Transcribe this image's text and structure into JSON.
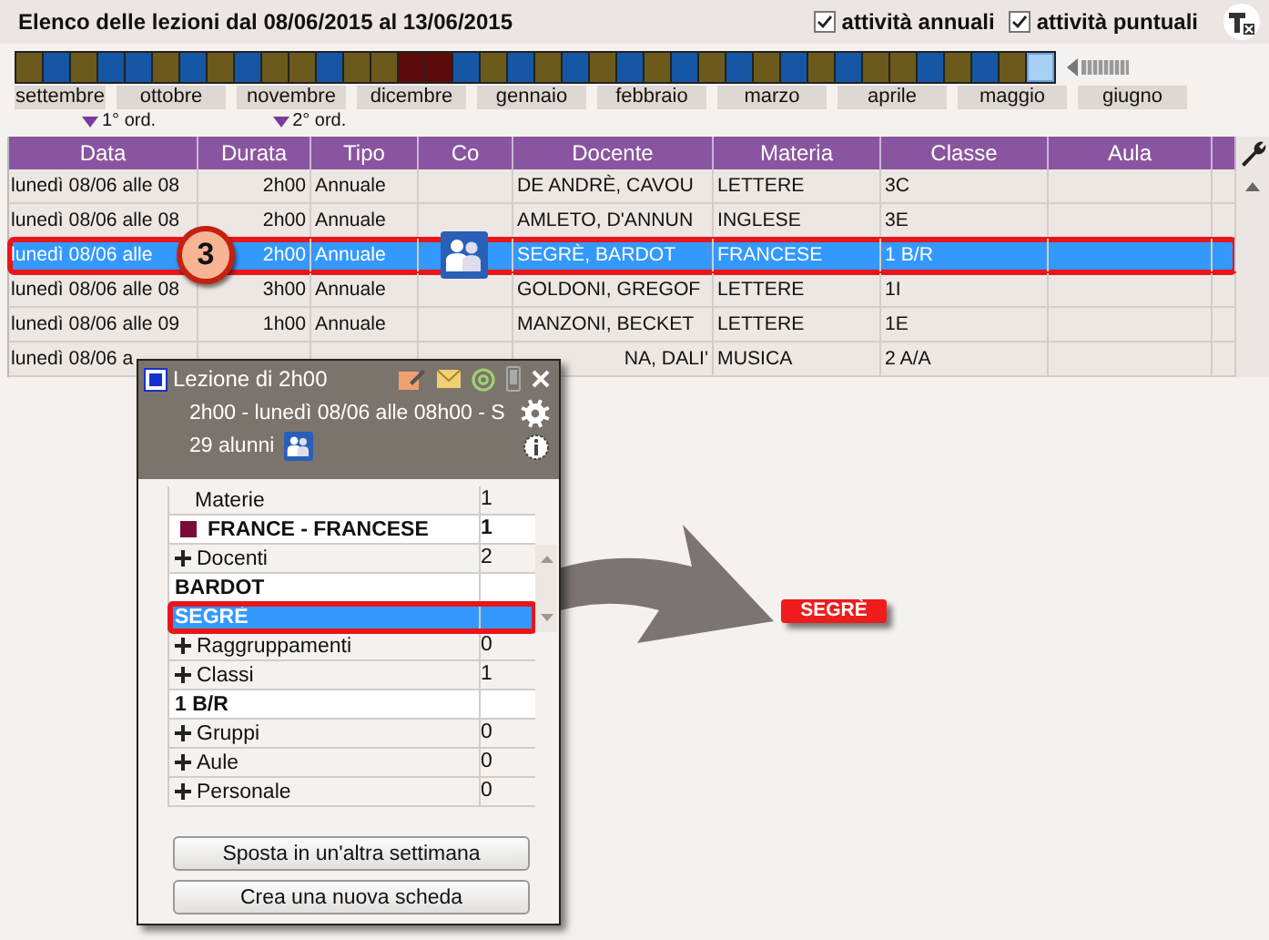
{
  "header": {
    "title": "Elenco delle lezioni dal 08/06/2015 al 13/06/2015",
    "filters": [
      {
        "label": "attività annuali",
        "checked": true
      },
      {
        "label": "attività puntuali",
        "checked": true
      }
    ]
  },
  "weeks": [
    {
      "color": "#6b5a1c",
      "selected": false
    },
    {
      "color": "#1557a4",
      "selected": false
    },
    {
      "color": "#6b5a1c",
      "selected": false
    },
    {
      "color": "#1557a4",
      "selected": false
    },
    {
      "color": "#1557a4",
      "selected": false
    },
    {
      "color": "#6b5a1c",
      "selected": false
    },
    {
      "color": "#1557a4",
      "selected": false
    },
    {
      "color": "#6b5a1c",
      "selected": false
    },
    {
      "color": "#1557a4",
      "selected": false
    },
    {
      "color": "#6b5a1c",
      "selected": false
    },
    {
      "color": "#6b5a1c",
      "selected": false
    },
    {
      "color": "#1557a4",
      "selected": false
    },
    {
      "color": "#6b5a1c",
      "selected": false
    },
    {
      "color": "#6b5a1c",
      "selected": false
    },
    {
      "color": "#5c0a0a",
      "selected": false
    },
    {
      "color": "#5c0a0a",
      "selected": false
    },
    {
      "color": "#1557a4",
      "selected": false
    },
    {
      "color": "#6b5a1c",
      "selected": false
    },
    {
      "color": "#1557a4",
      "selected": false
    },
    {
      "color": "#6b5a1c",
      "selected": false
    },
    {
      "color": "#1557a4",
      "selected": false
    },
    {
      "color": "#6b5a1c",
      "selected": false
    },
    {
      "color": "#1557a4",
      "selected": false
    },
    {
      "color": "#6b5a1c",
      "selected": false
    },
    {
      "color": "#1557a4",
      "selected": false
    },
    {
      "color": "#6b5a1c",
      "selected": false
    },
    {
      "color": "#1557a4",
      "selected": false
    },
    {
      "color": "#6b5a1c",
      "selected": false
    },
    {
      "color": "#1557a4",
      "selected": false
    },
    {
      "color": "#6b5a1c",
      "selected": false
    },
    {
      "color": "#1557a4",
      "selected": false
    },
    {
      "color": "#6b5a1c",
      "selected": false
    },
    {
      "color": "#6b5a1c",
      "selected": false
    },
    {
      "color": "#1557a4",
      "selected": false
    },
    {
      "color": "#6b5a1c",
      "selected": false
    },
    {
      "color": "#1557a4",
      "selected": false
    },
    {
      "color": "#6b5a1c",
      "selected": false
    },
    {
      "color": "#a8d0f5",
      "selected": true
    }
  ],
  "months": [
    "settembre",
    "ottobre",
    "novembre",
    "dicembre",
    "gennaio",
    "febbraio",
    "marzo",
    "aprile",
    "maggio",
    "giugno"
  ],
  "markers": [
    "1° ord.",
    "2° ord."
  ],
  "table": {
    "columns": [
      "Data",
      "Durata",
      "Tipo",
      "Co",
      "Docente",
      "Materia",
      "Classe",
      "Aula"
    ],
    "rows": [
      {
        "data": "lunedì 08/06 alle 08",
        "durata": "2h00",
        "tipo": "Annuale",
        "docente": "DE ANDRÈ, CAVOU",
        "materia": "LETTERE",
        "classe": "3C",
        "selected": false
      },
      {
        "data": "lunedì 08/06 alle 08",
        "durata": "2h00",
        "tipo": "Annuale",
        "docente": "AMLETO, D'ANNUN",
        "materia": "INGLESE",
        "classe": "3E",
        "selected": false
      },
      {
        "data": "lunedì 08/06 alle",
        "durata": "2h00",
        "tipo": "Annuale",
        "group_icon": true,
        "docente": "SEGRÈ, BARDOT",
        "materia": "FRANCESE",
        "classe": "1 B/R",
        "selected": true
      },
      {
        "data": "lunedì 08/06 alle 08",
        "durata": "3h00",
        "tipo": "Annuale",
        "docente": "GOLDONI, GREGOF",
        "materia": "LETTERE",
        "classe": "1I",
        "selected": false
      },
      {
        "data": "lunedì 08/06 alle 09",
        "durata": "1h00",
        "tipo": "Annuale",
        "docente": "MANZONI, BECKET",
        "materia": "LETTERE",
        "classe": "1E",
        "selected": false
      },
      {
        "data": "lunedì 08/06 a",
        "docente": "NA, DALI'",
        "materia": "MUSICA",
        "classe": "2 A/A",
        "selected": false
      }
    ]
  },
  "step_badge": "3",
  "popup": {
    "title": "Lezione di 2h00",
    "summary": "2h00  -  lunedì 08/06 alle 08h00  -  S",
    "students": "29 alunni",
    "rows": [
      {
        "kind": "heading",
        "label": "Materie",
        "count": "1"
      },
      {
        "kind": "subject",
        "label": "FRANCE - FRANCESE",
        "count": "1",
        "color": "#7a0c3c"
      },
      {
        "kind": "group",
        "label": "Docenti",
        "count": "2"
      },
      {
        "kind": "item",
        "label": "BARDOT",
        "selected": false
      },
      {
        "kind": "item",
        "label": "SEGRÈ",
        "selected": true
      },
      {
        "kind": "group",
        "label": "Raggruppamenti",
        "count": "0"
      },
      {
        "kind": "group",
        "label": "Classi",
        "count": "1"
      },
      {
        "kind": "item",
        "label": "1 B/R",
        "selected": false
      },
      {
        "kind": "group",
        "label": "Gruppi",
        "count": "0"
      },
      {
        "kind": "group",
        "label": "Aule",
        "count": "0"
      },
      {
        "kind": "group",
        "label": "Personale",
        "count": "0"
      }
    ],
    "buttons": [
      "Sposta in un'altra settimana",
      "Crea una nuova scheda"
    ]
  },
  "drag_tag": "SEGRÈ"
}
